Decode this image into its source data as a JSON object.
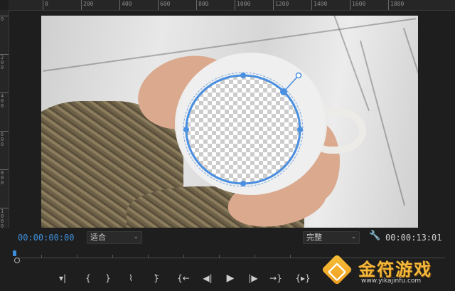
{
  "ruler": {
    "top_labels": [
      "0",
      "200",
      "400",
      "600",
      "800",
      "1000",
      "1200",
      "1400",
      "1600",
      "1800"
    ],
    "left_labels": [
      "0",
      "200",
      "400",
      "600",
      "800",
      "1000"
    ]
  },
  "viewer": {
    "content": "hands holding white coffee cup with circular mask",
    "mask_color": "#4a8fe0"
  },
  "controls": {
    "current_time": "00:00:00:00",
    "zoom_select": "适合",
    "quality_select": "完整",
    "duration": "00:00:13:01"
  },
  "transport": {
    "buttons": [
      {
        "name": "add-marker-button",
        "icon": "marker-icon",
        "glyph": "▾|"
      },
      {
        "name": "mark-in-button",
        "icon": "mark-in-icon",
        "glyph": "{"
      },
      {
        "name": "mark-out-button",
        "icon": "mark-out-icon",
        "glyph": "}"
      },
      {
        "name": "clear-in-out-button",
        "icon": "clear-in-out-icon",
        "glyph": "⌇"
      },
      {
        "name": "go-to-out-button",
        "icon": "go-to-out-icon",
        "glyph": "}⃖"
      },
      {
        "name": "go-to-in-button",
        "icon": "go-to-in-icon",
        "glyph": "{←"
      },
      {
        "name": "step-back-button",
        "icon": "step-back-icon",
        "glyph": "◀|"
      },
      {
        "name": "play-button",
        "icon": "play-icon",
        "glyph": "▶"
      },
      {
        "name": "step-forward-button",
        "icon": "step-forward-icon",
        "glyph": "|▶"
      },
      {
        "name": "go-to-end-button",
        "icon": "go-to-end-icon",
        "glyph": "→}"
      },
      {
        "name": "insert-button",
        "icon": "insert-icon",
        "glyph": "{▸}"
      }
    ]
  },
  "watermark": {
    "title": "金符游戏",
    "url": "www.yikajinfu.com",
    "accent": "#f4b83a"
  }
}
